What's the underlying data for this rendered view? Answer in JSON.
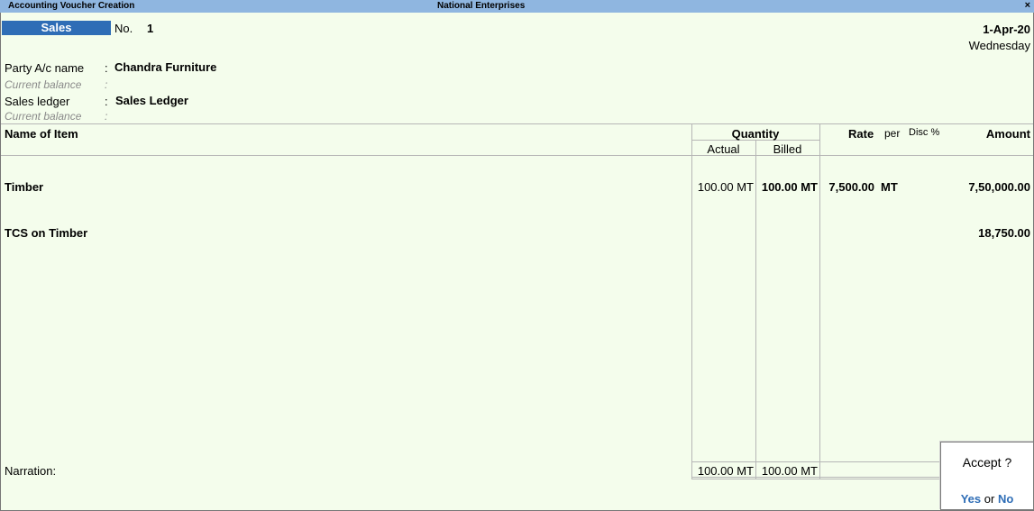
{
  "window": {
    "title": "Accounting Voucher Creation",
    "company": "National Enterprises",
    "close_icon": "×"
  },
  "voucher": {
    "type": "Sales",
    "no_label": "No.",
    "no_value": "1",
    "date": "1-Apr-20",
    "day": "Wednesday"
  },
  "header": {
    "party_label": "Party A/c name",
    "party_value": "Chandra Furniture",
    "current_balance_label": "Current balance",
    "sales_ledger_label": "Sales ledger",
    "sales_ledger_value": "Sales Ledger",
    "colon": ":"
  },
  "table": {
    "col_name": "Name of Item",
    "col_quantity": "Quantity",
    "col_actual": "Actual",
    "col_billed": "Billed",
    "col_rate": "Rate",
    "col_per": "per",
    "col_disc": "Disc %",
    "col_amount": "Amount",
    "rows": [
      {
        "name": "Timber",
        "actual": "100.00 MT",
        "billed": "100.00 MT",
        "rate": "7,500.00",
        "per": "MT",
        "amount": "7,50,000.00"
      },
      {
        "name": "TCS on Timber",
        "amount": "18,750.00"
      }
    ],
    "total_actual": "100.00 MT",
    "total_billed": "100.00 MT"
  },
  "narration_label": "Narration:",
  "accept_dialog": {
    "question": "Accept ?",
    "yes": "Yes",
    "or": "or",
    "no": "No"
  }
}
